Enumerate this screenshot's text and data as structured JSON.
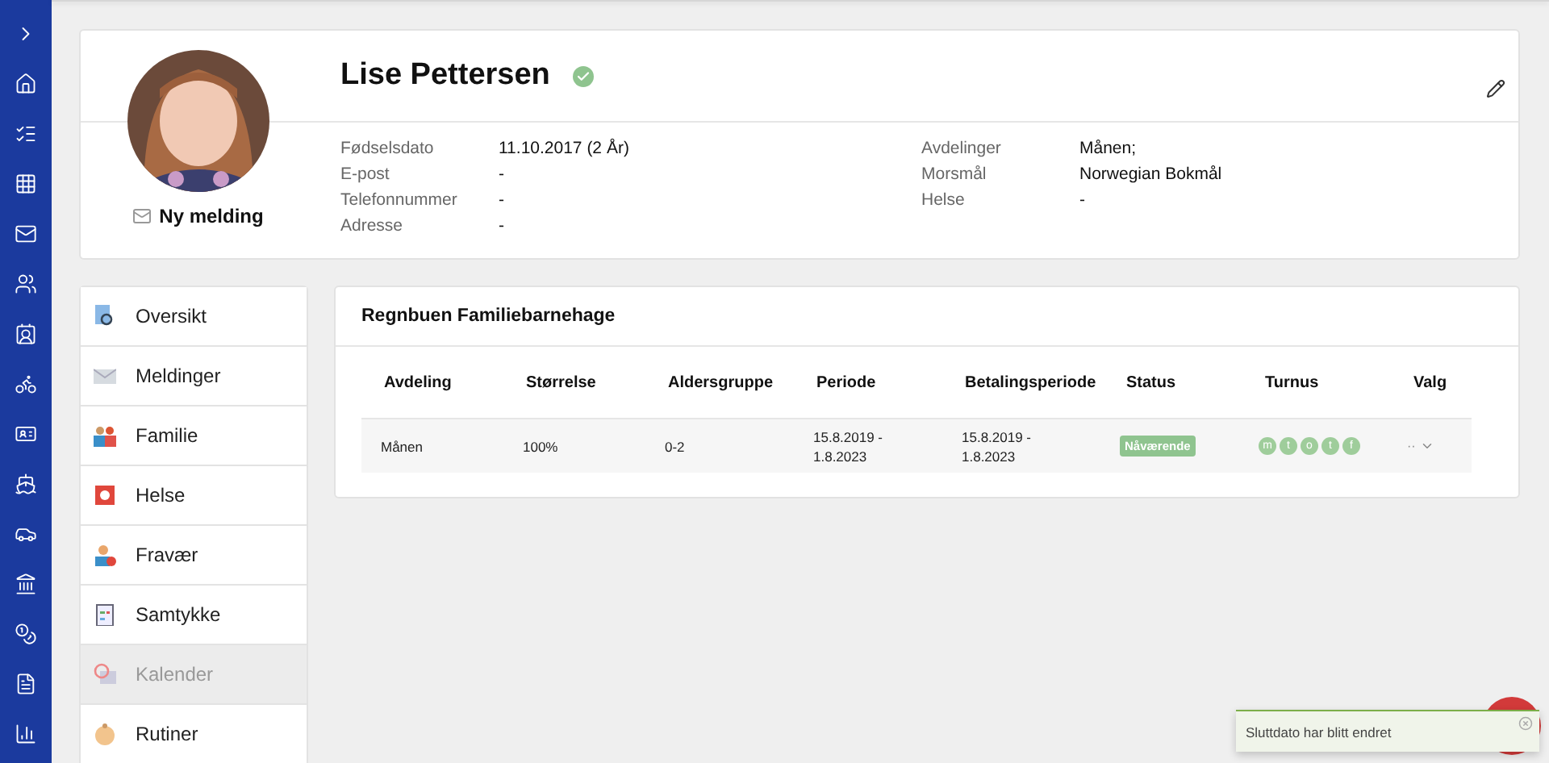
{
  "profile": {
    "name": "Lise Pettersen",
    "verified": true,
    "message_link": "Ny melding",
    "fields_left": [
      {
        "label": "Fødselsdato",
        "value": "11.10.2017 (2 År)"
      },
      {
        "label": "E-post",
        "value": "-"
      },
      {
        "label": "Telefonnummer",
        "value": "-"
      },
      {
        "label": "Adresse",
        "value": "-"
      }
    ],
    "fields_right": [
      {
        "label": "Avdelinger",
        "value": "Månen;"
      },
      {
        "label": "Morsmål",
        "value": "Norwegian Bokmål"
      },
      {
        "label": "Helse",
        "value": "-"
      }
    ]
  },
  "nav": [
    {
      "label": "Oversikt",
      "kind": "overview",
      "selected": false
    },
    {
      "label": "Meldinger",
      "kind": "mail",
      "selected": false
    },
    {
      "label": "Familie",
      "kind": "family",
      "selected": false
    },
    {
      "label": "Helse",
      "kind": "health",
      "selected": false
    },
    {
      "label": "Fravær",
      "kind": "absence",
      "selected": false
    },
    {
      "label": "Samtykke",
      "kind": "consent",
      "selected": false
    },
    {
      "label": "Kalender",
      "kind": "calendar",
      "selected": true
    },
    {
      "label": "Rutiner",
      "kind": "baby",
      "selected": false
    }
  ],
  "placement": {
    "title": "Regnbuen Familiebarnehage",
    "columns": [
      "Avdeling",
      "Størrelse",
      "Aldersgruppe",
      "Periode",
      "Betalingsperiode",
      "Status",
      "Turnus",
      "Valg"
    ],
    "rows": [
      {
        "avdeling": "Månen",
        "size": "100%",
        "age": "0-2",
        "period": [
          "15.8.2019 -",
          "1.8.2023"
        ],
        "payment": [
          "15.8.2019 -",
          "1.8.2023"
        ],
        "status": "Nåværende",
        "days": [
          "m",
          "t",
          "o",
          "t",
          "f"
        ],
        "menu": "··"
      }
    ]
  },
  "toast": {
    "message": "Sluttdato har blitt endret"
  }
}
